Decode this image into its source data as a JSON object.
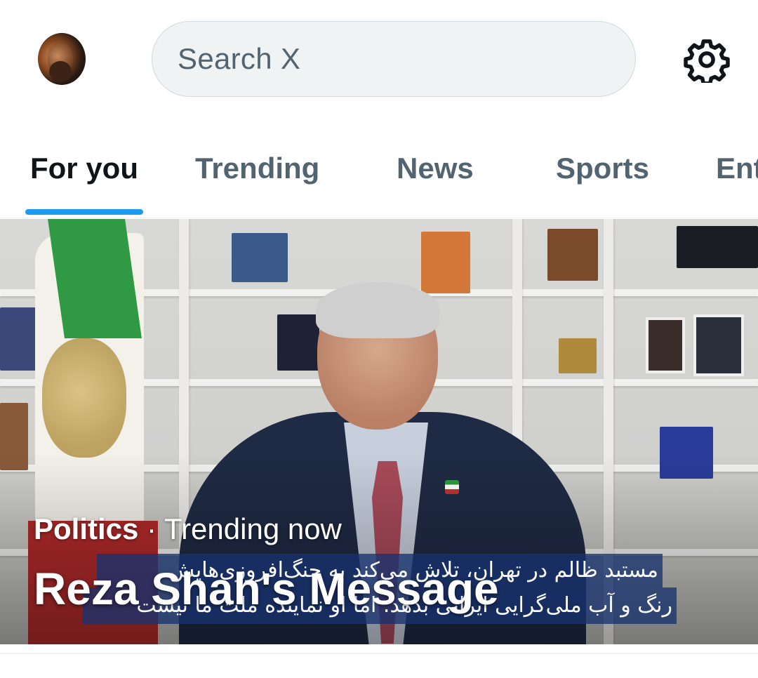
{
  "header": {
    "search_placeholder": "Search X",
    "avatar_icon": "user-avatar",
    "settings_icon": "gear-icon"
  },
  "tabs": [
    {
      "label": "For you",
      "active": true
    },
    {
      "label": "Trending",
      "active": false
    },
    {
      "label": "News",
      "active": false
    },
    {
      "label": "Sports",
      "active": false
    },
    {
      "label": "Ent",
      "active": false
    }
  ],
  "hero": {
    "category": "Politics",
    "separator": " · ",
    "status": "Trending now",
    "title": "Reza Shah's Message",
    "subtitle_line1": "مستبد ظالم در تهران، تلاش می‌کند به جنگ‌افروزی‌هایش",
    "subtitle_line2": "رنگ و آب ملی‌گرایی ایرانی بدهد. اما او نماینده ملت ما نیست"
  },
  "colors": {
    "accent": "#1d9bf0",
    "text_primary": "#0f1419",
    "text_secondary": "#536471",
    "search_bg": "#eff3f4"
  }
}
